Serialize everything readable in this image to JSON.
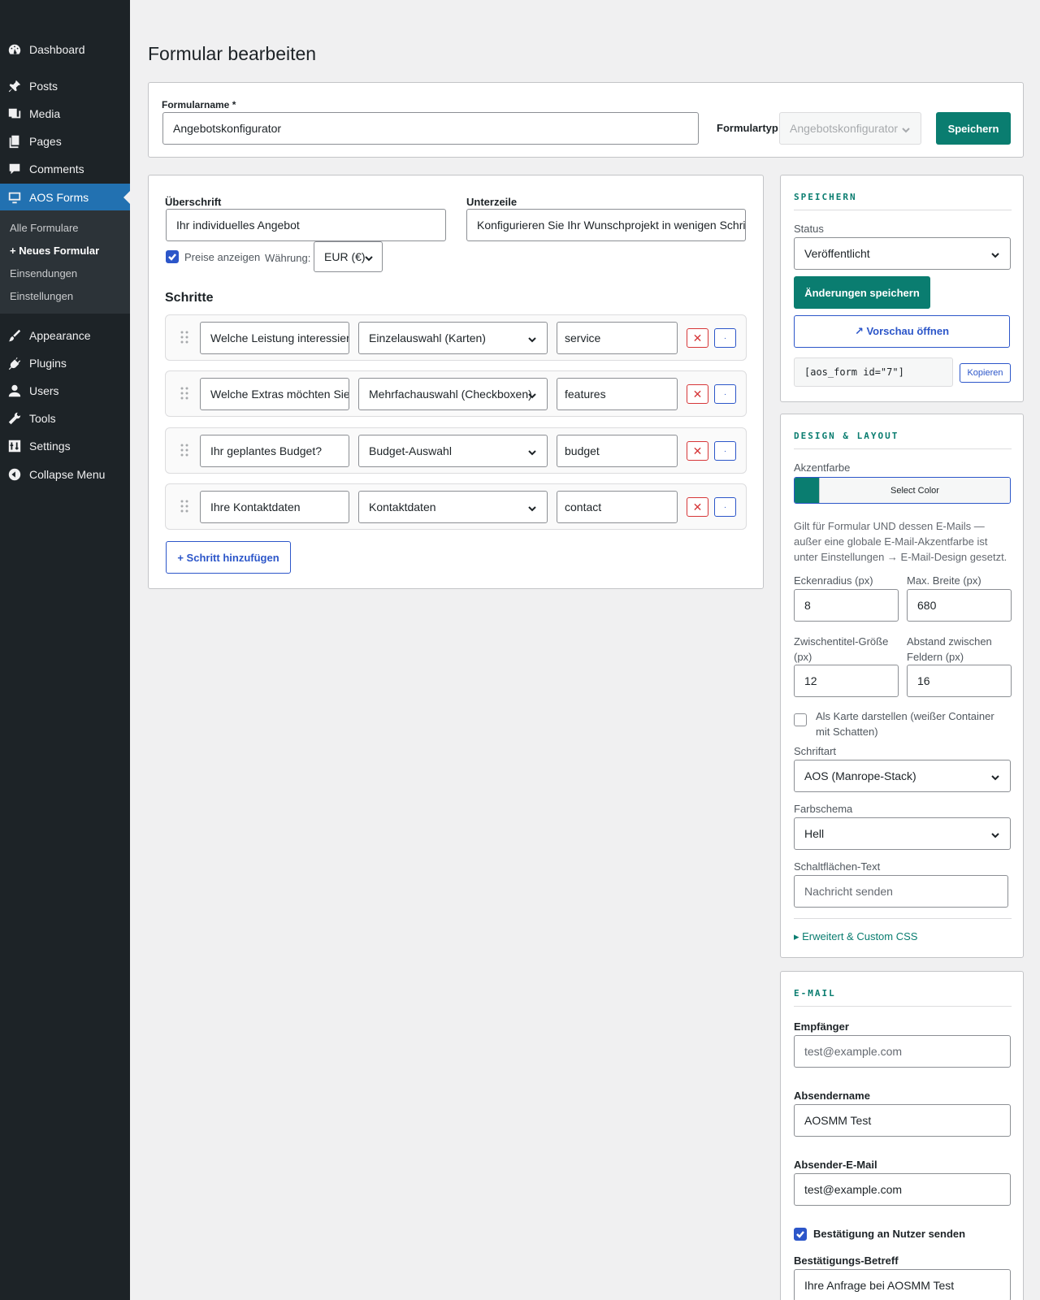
{
  "sidebar": {
    "items": [
      {
        "label": "Dashboard",
        "icon": "dashboard-icon"
      },
      {
        "label": "Posts",
        "icon": "pin-icon"
      },
      {
        "label": "Media",
        "icon": "media-icon"
      },
      {
        "label": "Pages",
        "icon": "pages-icon"
      },
      {
        "label": "Comments",
        "icon": "comment-icon"
      },
      {
        "label": "AOS Forms",
        "icon": "monitor-icon"
      },
      {
        "label": "Appearance",
        "icon": "brush-icon"
      },
      {
        "label": "Plugins",
        "icon": "plug-icon"
      },
      {
        "label": "Users",
        "icon": "user-icon"
      },
      {
        "label": "Tools",
        "icon": "wrench-icon"
      },
      {
        "label": "Settings",
        "icon": "sliders-icon"
      },
      {
        "label": "Collapse Menu",
        "icon": "collapse-icon"
      }
    ],
    "submenu": [
      "Alle Formulare",
      "+ Neues Formular",
      "Einsendungen",
      "Einstellungen"
    ]
  },
  "page": {
    "title": "Formular bearbeiten"
  },
  "topbar": {
    "name_label": "Formularname *",
    "name_value": "Angebotskonfigurator",
    "type_label": "Formulartyp",
    "type_value": "Angebotskonfigurator",
    "save_label": "Speichern"
  },
  "main": {
    "heading_label": "Überschrift",
    "heading_value": "Ihr individuelles Angebot",
    "sub_label": "Unterzeile",
    "sub_value": "Konfigurieren Sie Ihr Wunschprojekt in wenigen Schritten",
    "prices_label": "Preise anzeigen",
    "currency_label": "Währung:",
    "currency_value": "EUR (€)",
    "steps_title": "Schritte",
    "steps": [
      {
        "question": "Welche Leistung interessiert Sie?",
        "type": "Einzelauswahl (Karten)",
        "key": "service"
      },
      {
        "question": "Welche Extras möchten Sie?",
        "type": "Mehrfachauswahl (Checkboxen)",
        "key": "features"
      },
      {
        "question": "Ihr geplantes Budget?",
        "type": "Budget-Auswahl",
        "key": "budget"
      },
      {
        "question": "Ihre Kontaktdaten",
        "type": "Kontaktdaten",
        "key": "contact"
      }
    ],
    "delete_glyph": "✕",
    "more_glyph": "·",
    "add_step_label": "+ Schritt hinzufügen"
  },
  "save_box": {
    "title": "SPEICHERN",
    "status_label": "Status",
    "status_value": "Veröffentlicht",
    "save_changes_label": "Änderungen speichern",
    "preview_label": "↗ Vorschau öffnen",
    "shortcode": "[aos_form id=\"7\"]",
    "copy_label": "Kopieren"
  },
  "design": {
    "title": "DESIGN & LAYOUT",
    "accent_label": "Akzentfarbe",
    "accent_color": "#0a7d70",
    "select_color_label": "Select Color",
    "accent_help": "Gilt für Formular UND dessen E-Mails — außer eine globale E-Mail-Akzentfarbe ist unter Einstellungen → E-Mail-Design gesetzt.",
    "radius_label": "Eckenradius (px)",
    "radius_value": "8",
    "maxwidth_label": "Max. Breite (px)",
    "maxwidth_value": "680",
    "subtitle_size_label": "Zwischentitel-Größe (px)",
    "subtitle_size_value": "12",
    "gap_label": "Abstand zwischen Feldern (px)",
    "gap_value": "16",
    "card_label": "Als Karte darstellen (weißer Container mit Schatten)",
    "font_label": "Schriftart",
    "font_value": "AOS (Manrope-Stack)",
    "scheme_label": "Farbschema",
    "scheme_value": "Hell",
    "button_text_label": "Schaltflächen-Text",
    "button_text_placeholder": "Nachricht senden",
    "advanced_label": "▸ Erweitert & Custom CSS"
  },
  "email": {
    "title": "E-MAIL",
    "recipient_label": "Empfänger",
    "recipient_placeholder": "test@example.com",
    "sender_name_label": "Absendername",
    "sender_name_value": "AOSMM Test",
    "sender_email_label": "Absender-E-Mail",
    "sender_email_value": "test@example.com",
    "confirm_label": "Bestätigung an Nutzer senden",
    "confirm_subject_label": "Bestätigungs-Betreff",
    "confirm_subject_value": "Ihre Anfrage bei AOSMM Test"
  },
  "colors": {
    "sidebar_bg": "#1d2327",
    "active_menu": "#2271b1",
    "accent": "#0a7d70",
    "link_blue": "#2c56c9",
    "danger": "#d63638"
  }
}
